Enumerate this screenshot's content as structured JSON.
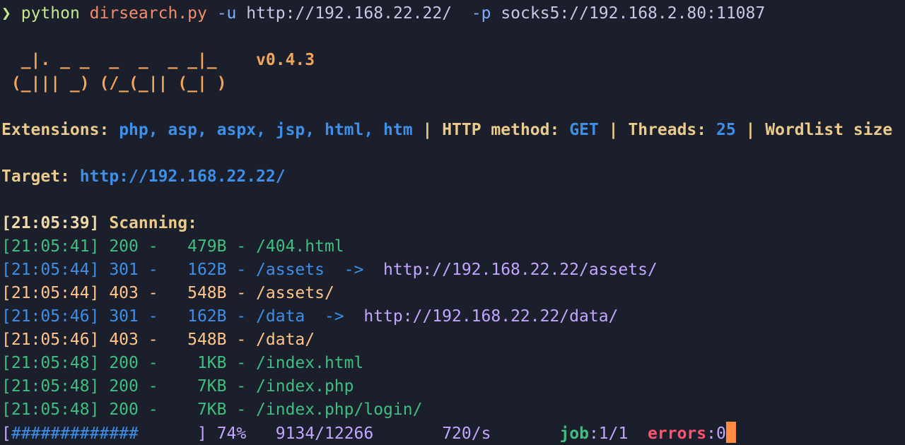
{
  "prompt": {
    "symbol": "❯",
    "program": "python",
    "script": "dirsearch.py",
    "flag_u": "-u",
    "url": "http://192.168.22.22/",
    "flag_p": "-p",
    "proxy": "socks5://192.168.2.80:11087"
  },
  "banner": {
    "art_line1": "  _|. _ _  _  _  _ _|_",
    "art_line2": " (_||| _) (/_(_|| (_| )",
    "version": "v0.4.3"
  },
  "config": {
    "extensions_label": "Extensions:",
    "extensions": "php, asp, aspx, jsp, html, htm",
    "method_label": "HTTP method:",
    "method": "GET",
    "threads_label": "Threads:",
    "threads": "25",
    "wordlist_label": "Wordlist size",
    "separator": "|"
  },
  "target": {
    "label": "Target:",
    "url": "http://192.168.22.22/"
  },
  "scanning": {
    "timestamp": "[21:05:39]",
    "label": "Scanning:"
  },
  "results": [
    {
      "line": "[21:05:41] 200 -   479B - /404.html",
      "redirect": ""
    },
    {
      "line": "[21:05:44] 301 -   162B - /assets  ->  ",
      "redirect": "http://192.168.22.22/assets/"
    },
    {
      "line": "[21:05:44] 403 -   548B - /assets/",
      "redirect": ""
    },
    {
      "line": "[21:05:46] 301 -   162B - /data  ->  ",
      "redirect": "http://192.168.22.22/data/"
    },
    {
      "line": "[21:05:46] 403 -   548B - /data/",
      "redirect": ""
    },
    {
      "line": "[21:05:48] 200 -    1KB - /index.html",
      "redirect": ""
    },
    {
      "line": "[21:05:48] 200 -    7KB - /index.php",
      "redirect": ""
    },
    {
      "line": "[21:05:48] 200 -    7KB - /index.php/login/",
      "redirect": ""
    }
  ],
  "progress": {
    "open": "[",
    "bar": "#############",
    "pad": "      ",
    "close": "]",
    "percent": "74%",
    "fraction": 0.74,
    "count": "9134/12266",
    "rate": "720/s",
    "job_label": "job",
    "job_value": ":1/1",
    "errors_label": "errors",
    "errors_value": ":0"
  },
  "colors": {
    "background": "#1b1e2b",
    "status_200": "#3fbf7f",
    "status_301": "#3d8fe8",
    "status_403": "#ffc58a",
    "cursor": "#ff8c42"
  }
}
